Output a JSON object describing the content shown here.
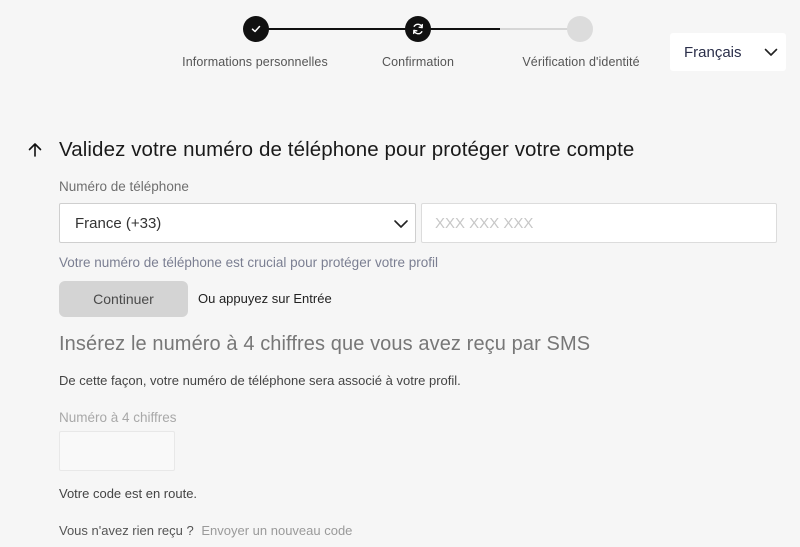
{
  "stepper": {
    "steps": [
      {
        "label": "Informations personnelles",
        "state": "done",
        "icon": "check-icon"
      },
      {
        "label": "Confirmation",
        "state": "current",
        "icon": "refresh-icon"
      },
      {
        "label": "Vérification d'identité",
        "state": "pending",
        "icon": ""
      }
    ],
    "colors": {
      "active": "#111111",
      "inactive": "#dcdcdc"
    }
  },
  "language": {
    "selected": "Français",
    "icon": "chevron-down-icon"
  },
  "header": {
    "back_icon": "arrow-up-icon",
    "title": "Validez votre numéro de téléphone pour protéger votre compte"
  },
  "phone": {
    "label": "Numéro de téléphone",
    "country": "France (+33)",
    "placeholder": "XXX XXX XXX",
    "value": "",
    "hint": "Votre numéro de téléphone est crucial pour protéger votre profil"
  },
  "actions": {
    "continue_label": "Continuer",
    "or_enter": "Ou appuyez sur Entrée"
  },
  "sms": {
    "title": "Insérez le numéro à 4 chiffres que vous avez reçu par SMS",
    "description": "De cette façon, votre numéro de téléphone sera associé à votre profil.",
    "code_label": "Numéro à 4 chiffres",
    "code_value": "",
    "status": "Votre code est en route.",
    "resend_question": "Vous n'avez rien reçu ?",
    "resend_link": "Envoyer un nouveau code"
  }
}
